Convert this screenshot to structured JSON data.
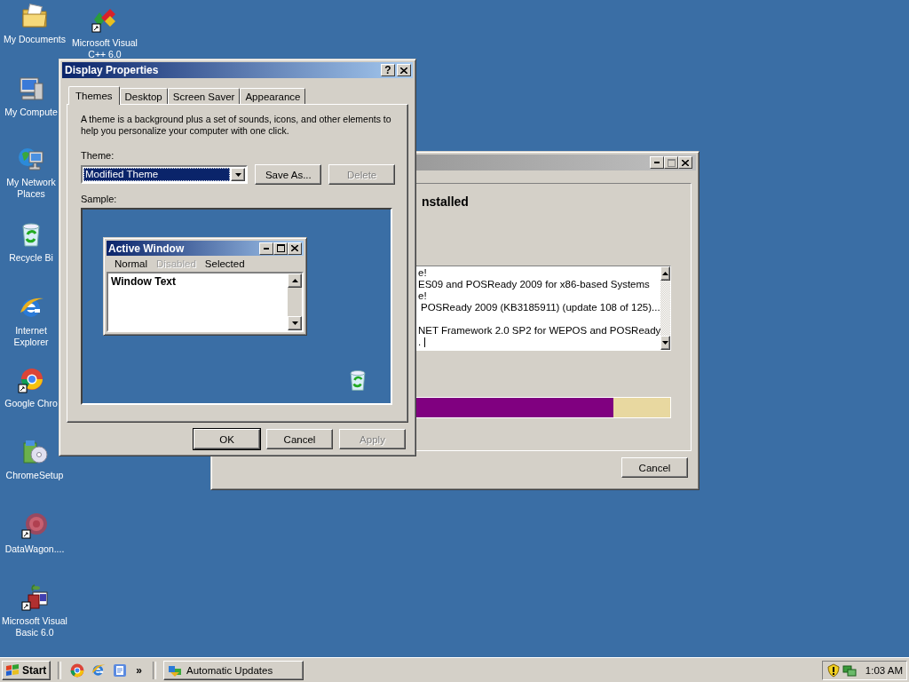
{
  "desktop_icons": [
    {
      "label": "My Documents"
    },
    {
      "label": "Microsoft Visual C++ 6.0"
    },
    {
      "label": "My Compute"
    },
    {
      "label": "My Network Places"
    },
    {
      "label": "Recycle Bi"
    },
    {
      "label": "Internet Explorer"
    },
    {
      "label": "Google Chro"
    },
    {
      "label": "ChromeSetup"
    },
    {
      "label": "DataWagon...."
    },
    {
      "label": "Microsoft Visual Basic 6.0"
    }
  ],
  "update_window": {
    "heading": "nstalled",
    "log_lines": [
      "e!",
      "ES09 and POSReady 2009 for x86-based Systems",
      "e!",
      "POSReady 2009 (KB3185911) (update 108 of 125)...",
      "NET Framework 2.0 SP2 for WEPOS and POSReady",
      "."
    ],
    "progress": {
      "level": 0.87
    },
    "cancel": "Cancel"
  },
  "display_properties": {
    "title": "Display Properties",
    "help_button": "?",
    "tabs": [
      {
        "label": "Themes",
        "selected": true
      },
      {
        "label": "Desktop",
        "selected": false
      },
      {
        "label": "Screen Saver",
        "selected": false
      },
      {
        "label": "Appearance",
        "selected": false
      }
    ],
    "description": "A theme is a background plus a set of sounds, icons, and other elements to help you personalize your computer with one click.",
    "theme_label": "Theme:",
    "theme_value": "Modified Theme",
    "theme_buttons": [
      {
        "label": "Save As...",
        "disabled": false
      },
      {
        "label": "Delete",
        "disabled": true
      }
    ],
    "sample_label": "Sample:",
    "sample": {
      "title": "Active Window",
      "menu": [
        {
          "label": "Normal",
          "disabled": false
        },
        {
          "label": "Disabled",
          "disabled": true
        },
        {
          "label": "Selected",
          "disabled": false
        }
      ],
      "text": "Window Text"
    },
    "buttons": [
      {
        "label": "OK",
        "disabled": false
      },
      {
        "label": "Cancel",
        "disabled": false
      },
      {
        "label": "Apply",
        "disabled": true
      }
    ]
  },
  "taskbar": {
    "start": "Start",
    "chevron": "»",
    "tasks": [
      {
        "label": "Automatic Updates",
        "selected": false
      }
    ],
    "clock": "1:03 AM"
  }
}
